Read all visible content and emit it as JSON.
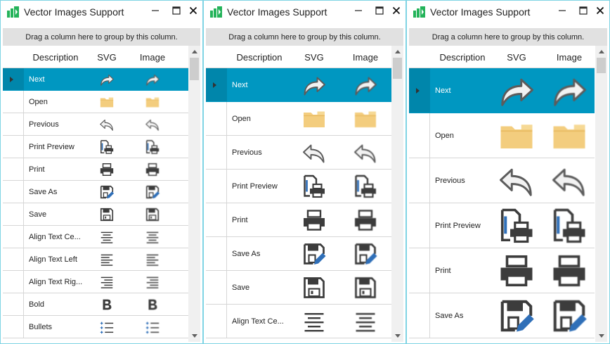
{
  "windows": [
    {
      "title": "Vector Images Support",
      "group_panel_text": "Drag a column here to group by this column.",
      "columns": [
        "Description",
        "SVG",
        "Image"
      ],
      "selected_row": 0,
      "rows": [
        {
          "description": "Next",
          "icon": "redo-arrow-icon"
        },
        {
          "description": "Open",
          "icon": "folder-icon"
        },
        {
          "description": "Previous",
          "icon": "undo-arrow-icon"
        },
        {
          "description": "Print Preview",
          "icon": "print-preview-icon"
        },
        {
          "description": "Print",
          "icon": "printer-icon"
        },
        {
          "description": "Save As",
          "icon": "save-as-icon"
        },
        {
          "description": "Save",
          "icon": "floppy-disk-icon"
        },
        {
          "description": "Align Text Ce...",
          "icon": "align-center-icon"
        },
        {
          "description": "Align Text Left",
          "icon": "align-left-icon"
        },
        {
          "description": "Align Text Rig...",
          "icon": "align-right-icon"
        },
        {
          "description": "Bold",
          "icon": "bold-icon"
        },
        {
          "description": "Bullets",
          "icon": "bullets-icon"
        }
      ]
    },
    {
      "title": "Vector Images Support",
      "group_panel_text": "Drag a column here to group by this column.",
      "columns": [
        "Description",
        "SVG",
        "Image"
      ],
      "selected_row": 0,
      "rows": [
        {
          "description": "Next",
          "icon": "redo-arrow-icon"
        },
        {
          "description": "Open",
          "icon": "folder-icon"
        },
        {
          "description": "Previous",
          "icon": "undo-arrow-icon"
        },
        {
          "description": "Print Preview",
          "icon": "print-preview-icon"
        },
        {
          "description": "Print",
          "icon": "printer-icon"
        },
        {
          "description": "Save As",
          "icon": "save-as-icon"
        },
        {
          "description": "Save",
          "icon": "floppy-disk-icon"
        },
        {
          "description": "Align Text Ce...",
          "icon": "align-center-icon"
        }
      ]
    },
    {
      "title": "Vector Images Support",
      "group_panel_text": "Drag a column here to group by this column.",
      "columns": [
        "Description",
        "SVG",
        "Image"
      ],
      "selected_row": 0,
      "rows": [
        {
          "description": "Next",
          "icon": "redo-arrow-icon"
        },
        {
          "description": "Open",
          "icon": "folder-icon"
        },
        {
          "description": "Previous",
          "icon": "undo-arrow-icon"
        },
        {
          "description": "Print Preview",
          "icon": "print-preview-icon"
        },
        {
          "description": "Print",
          "icon": "printer-icon"
        },
        {
          "description": "Save As",
          "icon": "save-as-icon"
        }
      ]
    }
  ],
  "colors": {
    "selection": "#0097c1",
    "selection_indicator": "#0086ab",
    "window_border": "#7fd4e4",
    "group_panel": "#e1e1e1",
    "folder": "#f3cd7e",
    "icon_dark": "#3c3c3c",
    "icon_blue": "#2f6fb8",
    "app_icon": "#24b35a"
  },
  "icons": {
    "app": "grid-app-icon",
    "minimize": "minimize-icon",
    "maximize": "maximize-icon",
    "close": "close-icon",
    "row_indicator": "triangle-right-icon",
    "scroll_up": "scroll-up-arrow-icon",
    "scroll_down": "scroll-down-arrow-icon"
  }
}
